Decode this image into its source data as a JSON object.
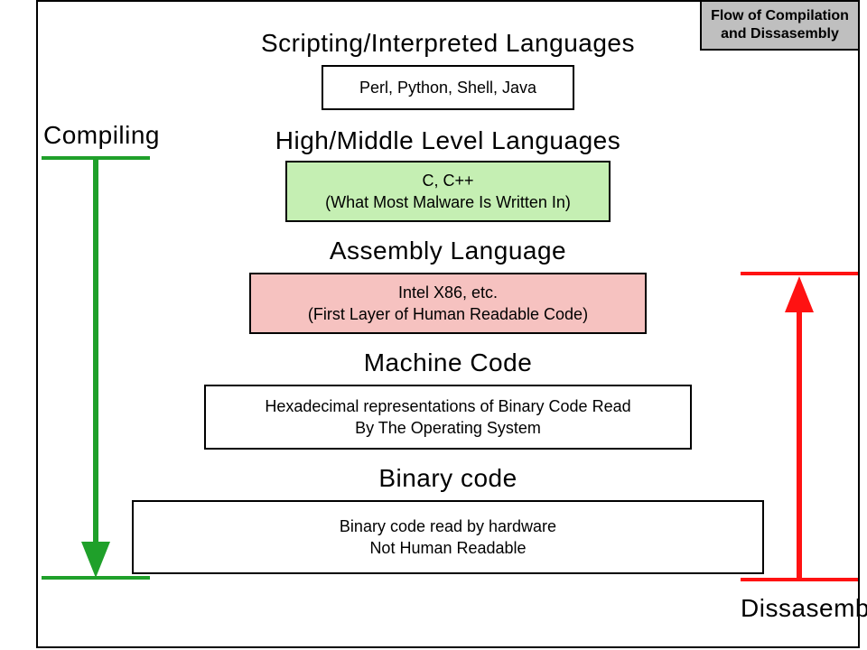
{
  "legend": {
    "line1": "Flow of Compilation",
    "line2": "and Dissasembly"
  },
  "left_label": "Compiling",
  "right_label": "Dissasemble",
  "levels": [
    {
      "heading": "Scripting/Interpreted Languages",
      "body": [
        "Perl, Python, Shell, Java"
      ],
      "fill": "white"
    },
    {
      "heading": "High/Middle Level Languages",
      "body": [
        "C, C++",
        "(What Most Malware Is Written In)"
      ],
      "fill": "green"
    },
    {
      "heading": "Assembly Language",
      "body": [
        "Intel X86, etc.",
        "(First Layer of Human Readable Code)"
      ],
      "fill": "pink"
    },
    {
      "heading": "Machine Code",
      "body": [
        "Hexadecimal representations of Binary Code Read",
        "By The Operating System"
      ],
      "fill": "white"
    },
    {
      "heading": "Binary code",
      "body": [
        "Binary code read by hardware",
        "Not Human Readable"
      ],
      "fill": "white"
    }
  ],
  "colors": {
    "compile_arrow": "#1fa02a",
    "disassemble_arrow": "#ff1212"
  }
}
